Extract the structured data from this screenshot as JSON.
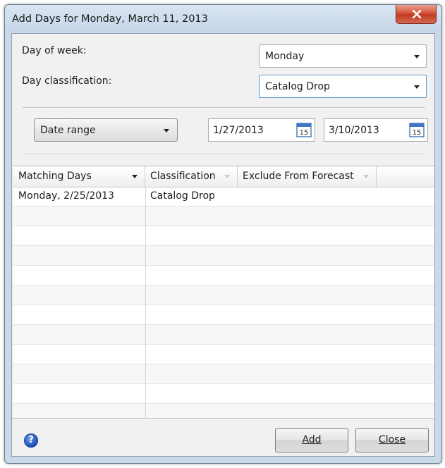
{
  "window": {
    "title": "Add Days for Monday, March 11, 2013"
  },
  "form": {
    "day_of_week_label": "Day of week:",
    "day_of_week_value": "Monday",
    "day_classification_label": "Day classification:",
    "day_classification_value": "Catalog Drop",
    "range_mode_value": "Date range",
    "start_date": "1/27/2013",
    "end_date": "3/10/2013",
    "calendar_icon_day": "15"
  },
  "grid": {
    "columns": [
      "Matching Days",
      "Classification",
      "Exclude From Forecast"
    ],
    "rows": [
      {
        "matching_day": "Monday, 2/25/2013",
        "classification": "Catalog Drop",
        "exclude": ""
      }
    ]
  },
  "footer": {
    "help_glyph": "?",
    "add_label": "Add",
    "close_label": "Close"
  },
  "icons": [
    "close-icon",
    "chevron-down-icon",
    "calendar-icon",
    "sort-arrow-icon",
    "help-icon"
  ],
  "colors": {
    "titlebar": "#c9d9ea",
    "close_button": "#c13a22",
    "focus_border": "#5b9bd5"
  }
}
